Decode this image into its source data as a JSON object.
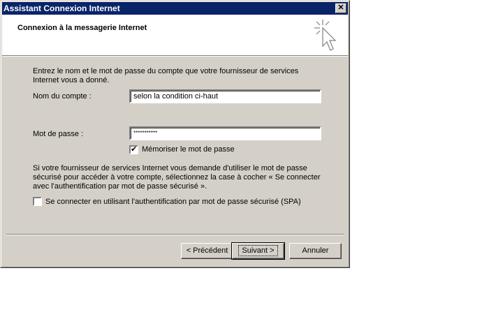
{
  "window": {
    "title": "Assistant Connexion Internet",
    "close_glyph": "✕"
  },
  "header": {
    "title": "Connexion à la messagerie Internet",
    "icon": "wizard-cursor-icon"
  },
  "intro": "Entrez le nom et le mot de passe du compte que votre fournisseur de services Internet vous a donné.",
  "account": {
    "label": "Nom du compte :",
    "value": "selon la condition ci-haut"
  },
  "password": {
    "label": "Mot de passe :",
    "value": "***********"
  },
  "remember": {
    "label": "Mémoriser le mot de passe",
    "checked": true,
    "mark": "✔"
  },
  "spa_note": "Si votre fournisseur de services Internet vous demande d'utiliser le mot de passe sécurisé pour accéder à votre compte, sélectionnez la case à cocher « Se connecter avec l'authentification par mot de passe sécurisé ».",
  "spa": {
    "label": "Se connecter en utilisant l'authentification par mot de passe sécurisé (SPA)",
    "checked": false
  },
  "buttons": {
    "back": "< Précédent",
    "next": "Suivant >",
    "cancel": "Annuler"
  }
}
